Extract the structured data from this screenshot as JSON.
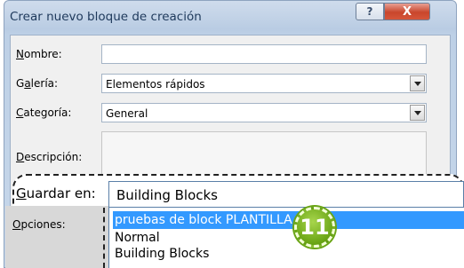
{
  "dialog": {
    "title": "Crear nuevo bloque de creación",
    "help_label": "?",
    "close_label": "X"
  },
  "form": {
    "nombre_label_u": "N",
    "nombre_label_rest": "ombre:",
    "nombre_value": "",
    "galeria_label_pre": "G",
    "galeria_label_u": "a",
    "galeria_label_rest": "lería:",
    "galeria_value": "Elementos rápidos",
    "categoria_label_u": "C",
    "categoria_label_rest": "ategoría:",
    "categoria_value": "General",
    "descripcion_label_u": "D",
    "descripcion_label_rest": "escripción:",
    "descripcion_value": ""
  },
  "zoom": {
    "guardar_label_u": "G",
    "guardar_label_rest": "uardar en:",
    "guardar_value": "Building Blocks",
    "opciones_label_u": "O",
    "opciones_label_rest": "pciones:",
    "options": [
      "pruebas de block PLANTILLA",
      "Normal",
      "Building Blocks"
    ],
    "selected_index": 0,
    "step_number": "11"
  },
  "colors": {
    "selection": "#3399ff",
    "badge": "#6aa515",
    "close_button": "#c9462c"
  }
}
